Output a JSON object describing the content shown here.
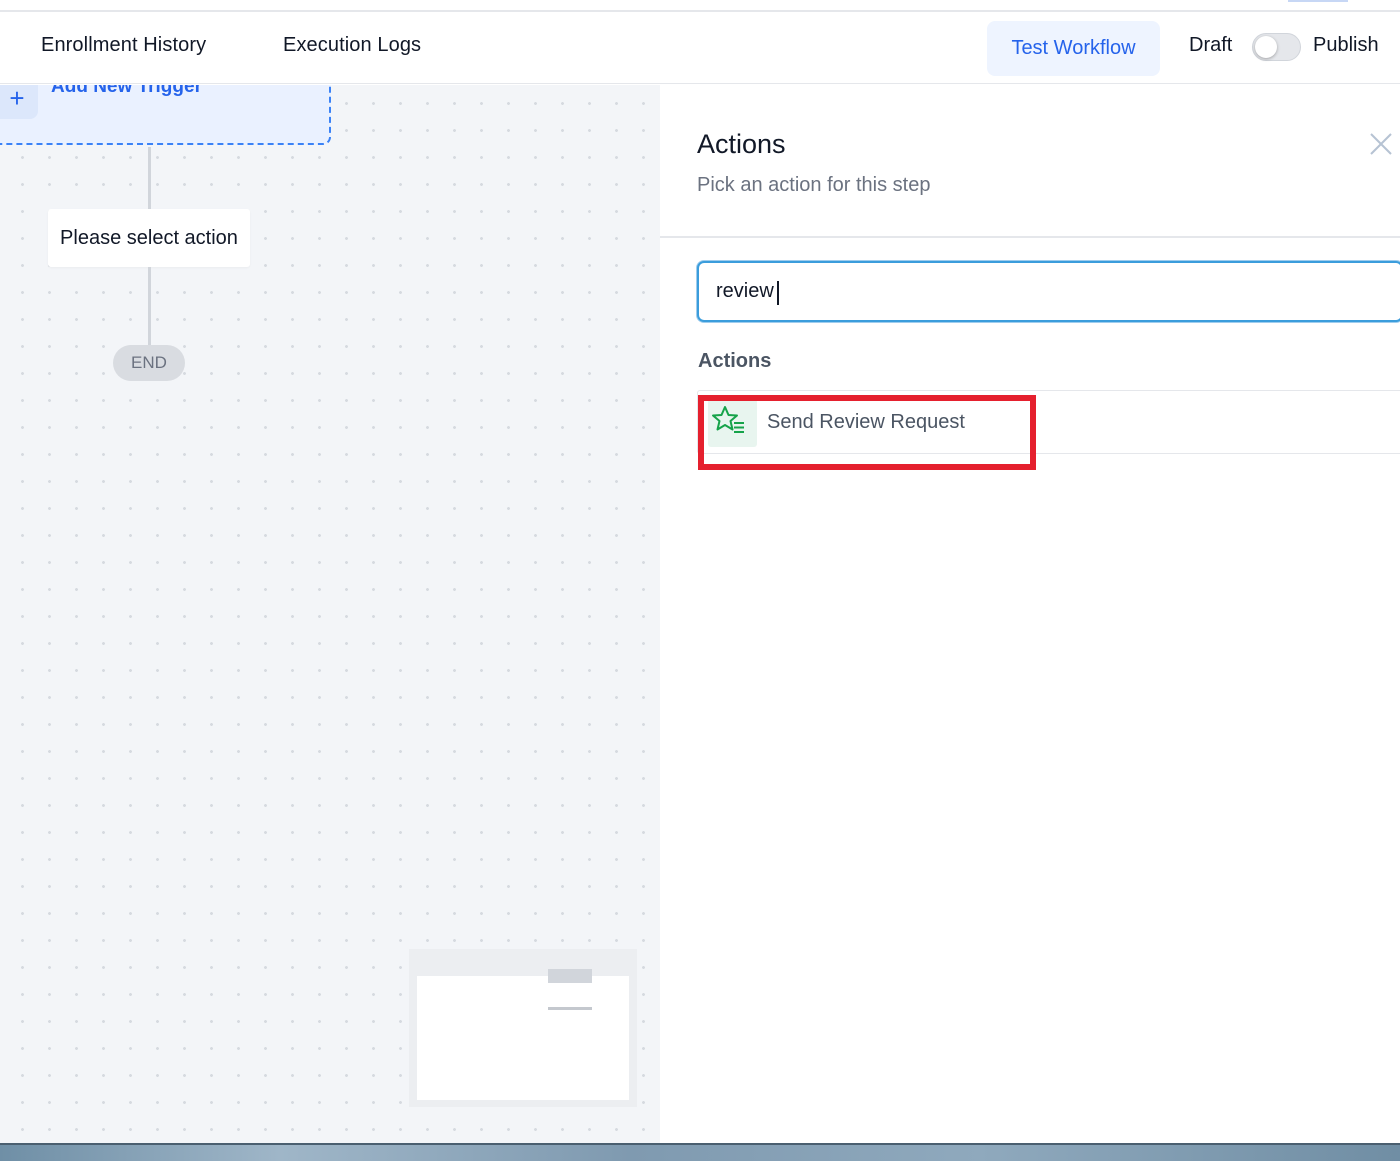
{
  "header": {
    "tabs": [
      {
        "label": "Enrollment History"
      },
      {
        "label": "Execution Logs"
      }
    ],
    "test_button_label": "Test Workflow",
    "draft_label": "Draft",
    "publish_label": "Publish",
    "publish_toggle_on": false
  },
  "canvas": {
    "trigger_label": "Add New Trigger",
    "trigger_icon": "plus-icon",
    "action_node_label": "Please select action",
    "end_label": "END"
  },
  "panel": {
    "title": "Actions",
    "subtitle": "Pick an action for this step",
    "close_icon": "close-icon",
    "search_value": "review",
    "section_heading": "Actions",
    "results": [
      {
        "label": "Send Review Request",
        "icon": "star-list-icon"
      }
    ]
  },
  "colors": {
    "accent": "#2563eb",
    "search_focus": "#3b9ddc",
    "highlight": "#e5202e",
    "icon_green": "#16a34a"
  }
}
